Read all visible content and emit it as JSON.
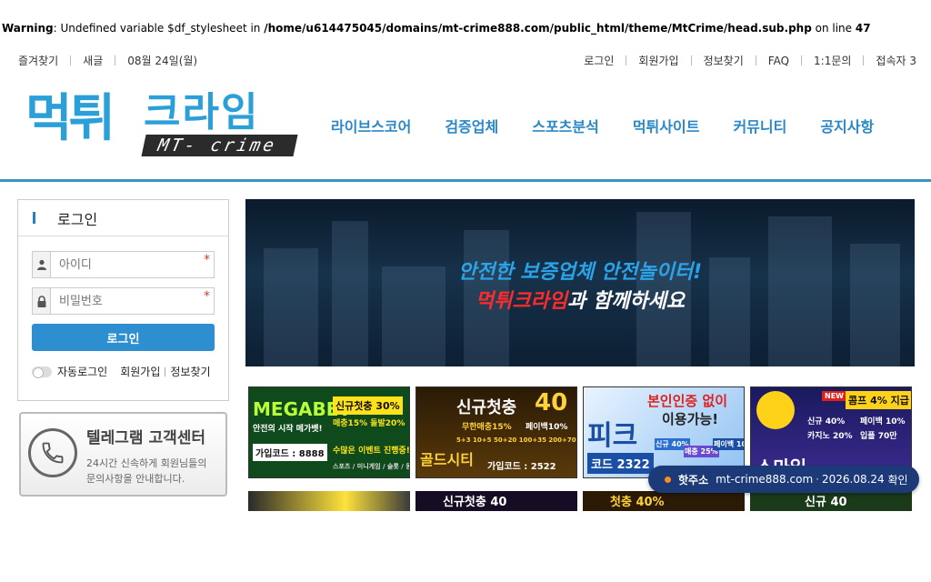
{
  "warning": {
    "prefix": "Warning",
    "msg": ": Undefined variable $df_stylesheet in ",
    "path": "/home/u614475045/domains/mt-crime888.com/public_html/theme/MtCrime/head.sub.php",
    "online": " on line ",
    "line": "47"
  },
  "topbar": {
    "left": [
      "즐겨찾기",
      "새글",
      "08월 24일(월)"
    ],
    "right": [
      "로그인",
      "회원가입",
      "정보찾기",
      "FAQ",
      "1:1문의",
      "접속자 3"
    ]
  },
  "logo": {
    "kr1": "먹튀",
    "kr2": "크라임",
    "en": "MT- crime"
  },
  "gnb": [
    "라이브스코어",
    "검증업체",
    "스포츠분석",
    "먹튀사이트",
    "커뮤니티",
    "공지사항"
  ],
  "login": {
    "title": "로그인",
    "id_placeholder": "아이디",
    "pw_placeholder": "비밀번호",
    "required_mark": "*",
    "button": "로그인",
    "auto_login": "자동로그인",
    "join": "회원가입",
    "find": "정보찾기"
  },
  "telegram": {
    "title": "텔레그램 고객센터",
    "desc1": "24시간 신속하게 회원님들의",
    "desc2": "문의사항을 안내합니다."
  },
  "hero": {
    "line1": "안전한 보증업체 안전놀이터!",
    "line2_red": "먹튀크라임",
    "line2_rest": "과 함께하세요"
  },
  "banners": [
    {
      "title": "MEGABET",
      "sub1": "안전의 시작 메가벳!",
      "badge": "신규첫충 30%",
      "sub2": "매충15% 돌발20%",
      "code_label": "가입코드 :",
      "code": "8888",
      "extra": "수많은 이벤트 진행중!",
      "extra2": "스포츠 / 미니게임 / 슬롯 / 동합카지노"
    },
    {
      "badge": "신규첫충",
      "big": "40",
      "sub1": "무한매충15%",
      "sub2": "페이백10%",
      "odds": "5+3 10+5 50+20 100+35 200+70",
      "name": "골드시티",
      "code_label": "가입코드 :",
      "code": "2522"
    },
    {
      "title": "본인인증 없이",
      "sub": "이용가능!",
      "name": "피크",
      "code_label": "코드",
      "code": "2322",
      "p1": "신규",
      "v1": "40%",
      "p2": "매충",
      "v2": "25%",
      "p3": "페이백",
      "v3": "10%"
    },
    {
      "new": "NEW",
      "badge": "콤프 4% 지급",
      "name": "스마일",
      "c1": "신규",
      "v1": "40%",
      "c2": "카지노",
      "v2": "20%",
      "c3": "페이백",
      "v3": "10%",
      "c4": "입플",
      "v4": "70만"
    }
  ],
  "banners_row2": [
    "",
    "신규첫충 40",
    "첫충 40%",
    "신규 40"
  ],
  "hotaddr": {
    "label": "핫주소",
    "domain": "mt-crime888.com",
    "sep": "·",
    "date": "2026.08.24",
    "confirm": "확인"
  },
  "colors": {
    "brand": "#2a9fd8",
    "nav": "#2a88c8",
    "accent_red": "#ff2b2b",
    "hot_bg": "#1c3a78"
  }
}
